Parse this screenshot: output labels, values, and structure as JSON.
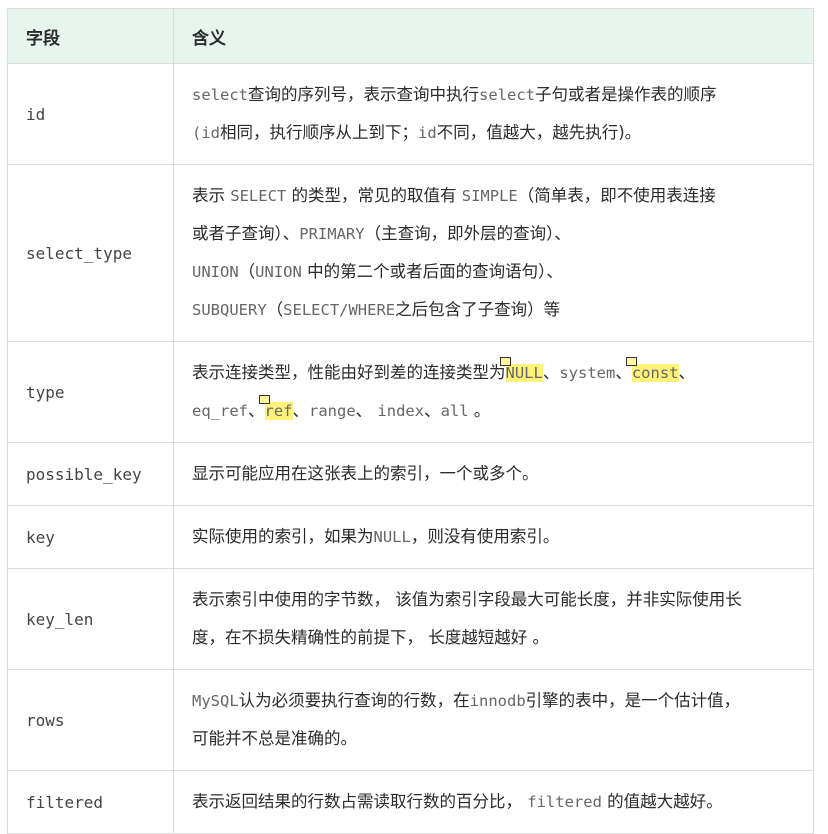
{
  "table": {
    "headers": {
      "field": "字段",
      "meaning": "含义"
    },
    "rows": [
      {
        "field": "id",
        "desc": [
          {
            "t": "select",
            "c": true
          },
          {
            "t": "查询的序列号，表示查询中执行"
          },
          {
            "t": "select",
            "c": true
          },
          {
            "t": "子句或者是操作表的顺序"
          },
          {
            "br": true
          },
          {
            "t": "(",
            "c": true
          },
          {
            "t": "id",
            "c": true
          },
          {
            "t": "相同，执行顺序从上到下；"
          },
          {
            "t": "id",
            "c": true
          },
          {
            "t": "不同，值越大，越先执行)",
            "c": false
          },
          {
            "t": "。"
          }
        ]
      },
      {
        "field": "select_type",
        "desc": [
          {
            "t": "表示 "
          },
          {
            "t": "SELECT",
            "c": true
          },
          {
            "t": " 的类型，常见的取值有 "
          },
          {
            "t": "SIMPLE",
            "c": true
          },
          {
            "t": "（简单表，即不使用表连接"
          },
          {
            "br": true
          },
          {
            "t": "或者子查询）、"
          },
          {
            "t": "PRIMARY",
            "c": true
          },
          {
            "t": "（主查询，即外层的查询）、"
          },
          {
            "br": true
          },
          {
            "t": "UNION",
            "c": true
          },
          {
            "t": "（"
          },
          {
            "t": "UNION",
            "c": true
          },
          {
            "t": " 中的第二个或者后面的查询语句）、"
          },
          {
            "br": true
          },
          {
            "t": "SUBQUERY",
            "c": true
          },
          {
            "t": "（"
          },
          {
            "t": "SELECT/WHERE",
            "c": true
          },
          {
            "t": "之后包含了子查询）等"
          }
        ]
      },
      {
        "field": "type",
        "desc": [
          {
            "t": "表示连接类型，性能由好到差的连接类型为"
          },
          {
            "t": "NULL",
            "c": true,
            "hl": true,
            "note": true
          },
          {
            "t": "、"
          },
          {
            "t": "system",
            "c": true
          },
          {
            "t": "、"
          },
          {
            "t": "const",
            "c": true,
            "hl": true,
            "note": true
          },
          {
            "t": "、"
          },
          {
            "br": true
          },
          {
            "t": "eq_ref",
            "c": true
          },
          {
            "t": "、"
          },
          {
            "t": "ref",
            "c": true,
            "hl": true,
            "note": true
          },
          {
            "t": "、"
          },
          {
            "t": "range",
            "c": true
          },
          {
            "t": "、 "
          },
          {
            "t": "index",
            "c": true
          },
          {
            "t": "、"
          },
          {
            "t": "all",
            "c": true
          },
          {
            "t": " 。"
          }
        ]
      },
      {
        "field": "possible_key",
        "desc": [
          {
            "t": "显示可能应用在这张表上的索引，一个或多个。"
          }
        ]
      },
      {
        "field": "key",
        "desc": [
          {
            "t": "实际使用的索引，如果为"
          },
          {
            "t": "NULL",
            "c": true
          },
          {
            "t": "，则没有使用索引。"
          }
        ]
      },
      {
        "field": "key_len",
        "desc": [
          {
            "t": "表示索引中使用的字节数， 该值为索引字段最大可能长度，并非实际使用长"
          },
          {
            "br": true
          },
          {
            "t": "度，在不损失精确性的前提下， 长度越短越好 。"
          }
        ]
      },
      {
        "field": "rows",
        "desc": [
          {
            "t": "MySQL",
            "c": true
          },
          {
            "t": "认为必须要执行查询的行数，在"
          },
          {
            "t": "innodb",
            "c": true
          },
          {
            "t": "引擎的表中，是一个估计值，"
          },
          {
            "br": true
          },
          {
            "t": "可能并不总是准确的。"
          }
        ]
      },
      {
        "field": "filtered",
        "desc": [
          {
            "t": "表示返回结果的行数占需读取行数的百分比， "
          },
          {
            "t": "filtered",
            "c": true
          },
          {
            "t": " 的值越大越好。"
          }
        ]
      }
    ]
  },
  "colors": {
    "header_bg": "#e8f5ee",
    "highlight": "#fff27a",
    "border": "#dcdcdc"
  }
}
